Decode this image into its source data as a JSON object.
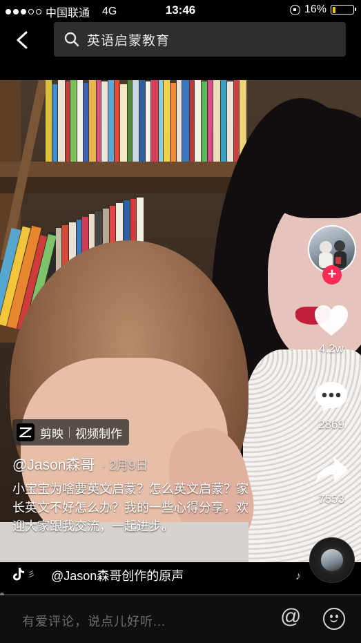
{
  "status_bar": {
    "carrier": "中国联通",
    "network": "4G",
    "time": "13:46",
    "battery": "16%",
    "battery_level": 0.16,
    "battery_color": "#f5c400"
  },
  "nav": {
    "back_icon": "chevron-left-icon",
    "search_query": "英语启蒙教育"
  },
  "video": {
    "actions": {
      "like_count": "4.2w",
      "comment_count": "2869",
      "share_count": "7553"
    },
    "follow_color": "#fe2c55",
    "capcut": {
      "app_name": "剪映",
      "tagline": "视频制作"
    },
    "author": "@Jason森哥",
    "date": "· 2月9日",
    "description": "小宝宝为啥要英文启蒙？怎么英文启蒙？家长英文不好怎么办？我的一些心得分享，欢迎大家跟我交流，一起进步。"
  },
  "music": {
    "text": "@Jason森哥创作的原声"
  },
  "comment_bar": {
    "placeholder": "有爱评论，说点儿好听..."
  }
}
